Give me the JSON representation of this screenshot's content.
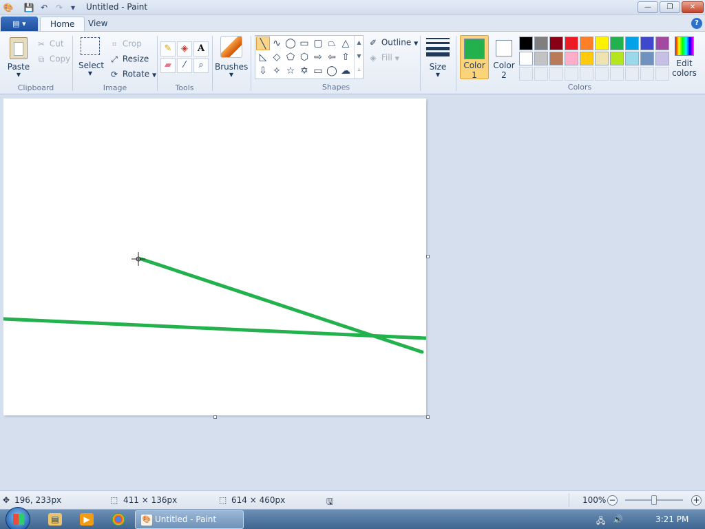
{
  "window": {
    "title": "Untitled - Paint",
    "minimize": "—",
    "maximize": "❐",
    "close": "✕"
  },
  "qat": {
    "customize": "▾"
  },
  "tabs": {
    "app_menu": "▤ ▾",
    "home": "Home",
    "view": "View",
    "help": "?"
  },
  "clipboard": {
    "paste": "Paste",
    "cut": "Cut",
    "copy": "Copy",
    "label": "Clipboard"
  },
  "image": {
    "select": "Select",
    "crop": "Crop",
    "resize": "Resize",
    "rotate": "Rotate",
    "label": "Image"
  },
  "tools": {
    "label": "Tools",
    "text_tool": "A"
  },
  "brushes": {
    "label": "Brushes"
  },
  "shapes": {
    "outline": "Outline",
    "fill": "Fill",
    "label": "Shapes"
  },
  "size": {
    "label": "Size"
  },
  "colors": {
    "label": "Colors",
    "color1_label_a": "Color",
    "color1_label_b": "1",
    "color2_label_a": "Color",
    "color2_label_b": "2",
    "edit_a": "Edit",
    "edit_b": "colors",
    "color1": "#22b14c",
    "color2": "#ffffff",
    "palette_row1": [
      "#000000",
      "#7f7f7f",
      "#880015",
      "#ed1c24",
      "#ff7f27",
      "#fff200",
      "#22b14c",
      "#00a2e8",
      "#3f48cc",
      "#a349a4"
    ],
    "palette_row2": [
      "#ffffff",
      "#c3c3c3",
      "#b97a57",
      "#ffaec9",
      "#ffc90e",
      "#efe4b0",
      "#b5e61d",
      "#99d9ea",
      "#7092be",
      "#c8bfe7"
    ]
  },
  "canvas": {
    "stroke_color": "#22b14c"
  },
  "status": {
    "cursor_pos": "196, 233px",
    "selection_size": "411 × 136px",
    "canvas_size": "614 × 460px",
    "zoom": "100%",
    "zoom_minus": "−",
    "zoom_plus": "+"
  },
  "taskbar": {
    "task_label": "Untitled - Paint",
    "clock": "3:21 PM"
  }
}
